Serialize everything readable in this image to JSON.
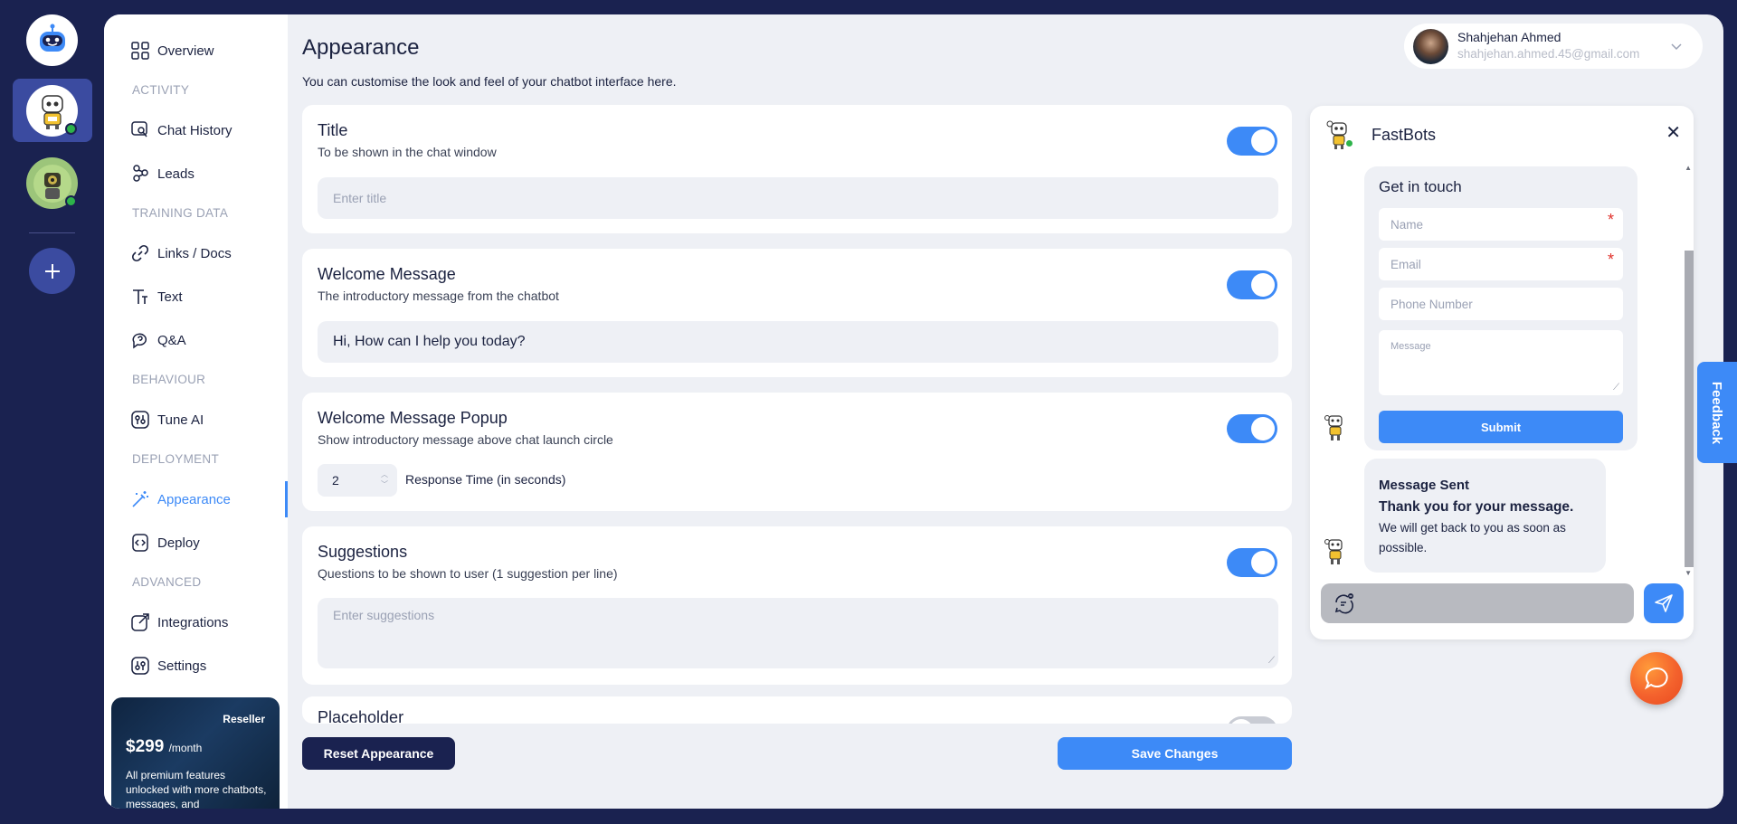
{
  "sidebar": {
    "overview": "Overview",
    "sections": {
      "activity": "ACTIVITY",
      "training": "TRAINING DATA",
      "behaviour": "BEHAVIOUR",
      "deployment": "DEPLOYMENT",
      "advanced": "ADVANCED"
    },
    "items": {
      "chat_history": "Chat History",
      "leads": "Leads",
      "links_docs": "Links / Docs",
      "text": "Text",
      "qa": "Q&A",
      "tune_ai": "Tune AI",
      "appearance": "Appearance",
      "deploy": "Deploy",
      "integrations": "Integrations",
      "settings": "Settings"
    },
    "promo": {
      "tag": "Reseller",
      "price": "$299",
      "period": "/month",
      "text": "All premium features unlocked with more chatbots, messages, and"
    }
  },
  "header": {
    "title": "Appearance",
    "subtitle": "You can customise the look and feel of your chatbot interface here.",
    "user_name": "Shahjehan Ahmed",
    "user_email": "shahjehan.ahmed.45@gmail.com"
  },
  "cards": {
    "title": {
      "label": "Title",
      "desc": "To be shown in the chat window",
      "placeholder": "Enter title",
      "enabled": true
    },
    "welcome": {
      "label": "Welcome Message",
      "desc": "The introductory message from the chatbot",
      "value": "Hi, How can I help you today?",
      "enabled": true
    },
    "popup": {
      "label": "Welcome Message Popup",
      "desc": "Show introductory message above chat launch circle",
      "response_time": "2",
      "response_label": "Response Time (in seconds)",
      "enabled": true
    },
    "suggestions": {
      "label": "Suggestions",
      "desc": "Questions to be shown to user (1 suggestion per line)",
      "placeholder": "Enter suggestions",
      "enabled": true
    },
    "placeholder": {
      "label": "Placeholder",
      "enabled": false
    }
  },
  "actions": {
    "reset": "Reset Appearance",
    "save": "Save Changes"
  },
  "chat": {
    "bot_name": "FastBots",
    "form": {
      "title": "Get in touch",
      "name_placeholder": "Name",
      "email_placeholder": "Email",
      "phone_placeholder": "Phone Number",
      "message_placeholder": "Message",
      "submit": "Submit"
    },
    "sent": {
      "title": "Message Sent",
      "subtitle": "Thank you for your message.",
      "body": "We will get back to you as soon as possible."
    }
  },
  "feedback": "Feedback",
  "colors": {
    "accent": "#3d8af7",
    "navy": "#1a2250",
    "online": "#2db34a",
    "launcher": "#f4622d"
  }
}
